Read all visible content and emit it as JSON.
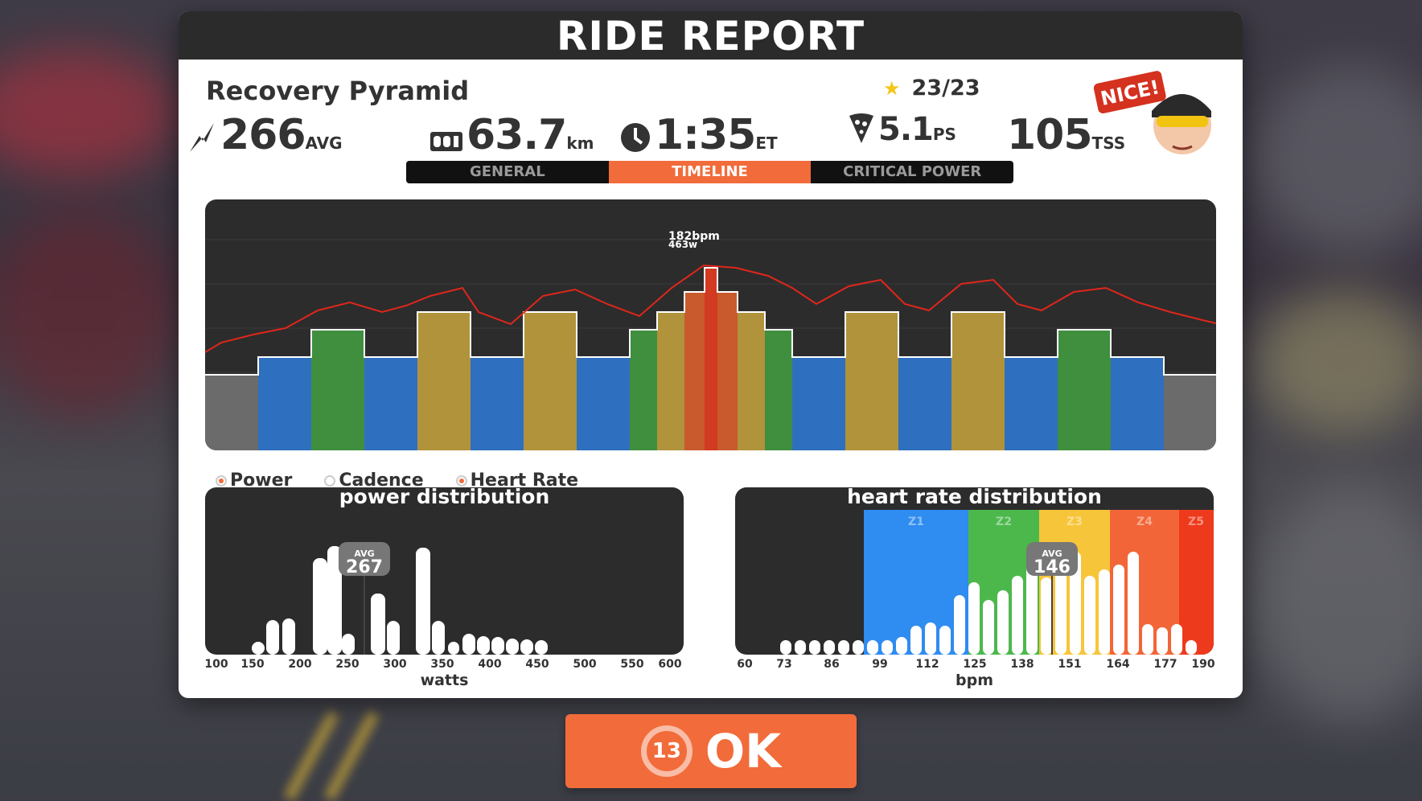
{
  "header": {
    "title": "RIDE REPORT"
  },
  "workout": {
    "name": "Recovery Pyramid",
    "stars": "23/23"
  },
  "stats": {
    "power": {
      "value": "266",
      "unit": "AVG",
      "icon": "power-bolt-icon"
    },
    "distance": {
      "value": "63.7",
      "unit": "km",
      "icon": "odometer-icon"
    },
    "time": {
      "value": "1:35",
      "unit": "ET",
      "icon": "clock-icon"
    },
    "pizza": {
      "value": "5.1",
      "unit": "PS",
      "icon": "pizza-icon"
    },
    "tss": {
      "value": "105",
      "unit": "TSS"
    }
  },
  "badge": {
    "text": "NICE!"
  },
  "tabs": [
    {
      "label": "GENERAL",
      "active": false
    },
    {
      "label": "TIMELINE",
      "active": true
    },
    {
      "label": "CRITICAL POWER",
      "active": false
    }
  ],
  "timeline": {
    "peak_hr_label": "182bpm",
    "peak_power_label": "463w",
    "zone_colors": {
      "recovery": "#6b6b6b",
      "endurance": "#2f6fbf",
      "tempo": "#3f8f3f",
      "threshold": "#b0933b",
      "vo2max": "#c85a2e",
      "anaerobic": "#d23a22"
    }
  },
  "legend": [
    {
      "label": "Power",
      "on": true
    },
    {
      "label": "Cadence",
      "on": false
    },
    {
      "label": "Heart Rate",
      "on": true
    }
  ],
  "power_distribution": {
    "title": "power distribution",
    "avg_label": "AVG",
    "avg_value": "267",
    "ticks": [
      "100",
      "150",
      "200",
      "250",
      "300",
      "350",
      "400",
      "450",
      "500",
      "550",
      "600"
    ],
    "axis_label": "watts"
  },
  "hr_distribution": {
    "title": "heart rate distribution",
    "avg_label": "AVG",
    "avg_value": "146",
    "zones": [
      "Z1",
      "Z2",
      "Z3",
      "Z4",
      "Z5"
    ],
    "zone_colors": [
      "#2f8cf0",
      "#4cb84c",
      "#f7c53a",
      "#f26538",
      "#ee3a1c"
    ],
    "ticks": [
      "60",
      "73",
      "86",
      "99",
      "112",
      "125",
      "138",
      "151",
      "164",
      "177",
      "190"
    ],
    "axis_label": "bpm"
  },
  "ok_button": {
    "label": "OK",
    "countdown": "13"
  }
}
